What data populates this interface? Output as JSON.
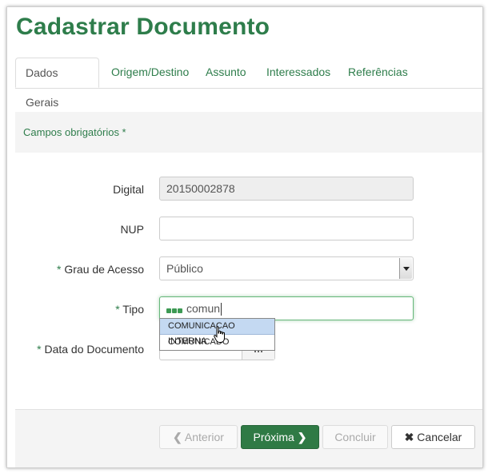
{
  "page": {
    "title": "Cadastrar Documento"
  },
  "tabs": [
    {
      "label": "Dados Gerais"
    },
    {
      "label": "Origem/Destino"
    },
    {
      "label": "Assunto"
    },
    {
      "label": "Interessados"
    },
    {
      "label": "Referências"
    }
  ],
  "required_note": "Campos obrigatórios *",
  "fields": {
    "digital": {
      "label": "Digital",
      "value": "20150002878"
    },
    "nup": {
      "label": "NUP",
      "value": ""
    },
    "grau": {
      "star": "*",
      "label": "Grau de Acesso",
      "value": "Público"
    },
    "tipo": {
      "star": "*",
      "label": "Tipo",
      "value": "comun"
    },
    "data": {
      "star": "*",
      "label": "Data do Documento"
    }
  },
  "autocomplete": [
    "COMUNICACAO INTERNA",
    "COMUNICADO"
  ],
  "buttons": {
    "anterior": "Anterior",
    "proxima": "Próxima",
    "concluir": "Concluir",
    "cancelar": "Cancelar"
  },
  "colors": {
    "brand_green": "#2e7d4b",
    "primary_button": "#2f7a45"
  }
}
